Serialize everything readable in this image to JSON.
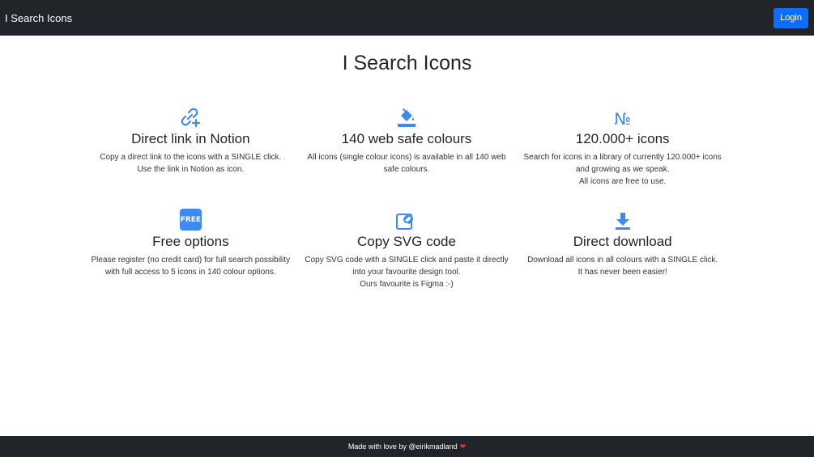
{
  "navbar": {
    "brand": "I Search Icons",
    "login_label": "Login"
  },
  "main": {
    "title": "I Search Icons"
  },
  "features": [
    {
      "icon": "link-plus-icon",
      "title": "Direct link in Notion",
      "lines": [
        "Copy a direct link to the icons with a SINGLE click.",
        "Use the link in Notion as icon."
      ]
    },
    {
      "icon": "paint-bucket-icon",
      "title": "140 web safe colours",
      "lines": [
        "All icons (single colour icons) is available in all 140 web safe colours."
      ]
    },
    {
      "icon": "numero-icon",
      "glyph": "№",
      "title": "120.000+ icons",
      "lines": [
        "Search for icons in a library of currently 120.000+ icons and growing as we speak.",
        "All icons are free to use."
      ]
    },
    {
      "icon": "free-badge-icon",
      "badge": "FREE",
      "title": "Free options",
      "lines": [
        "Please register (no credit card) for full search possibility with full access to 5 icons in 140 colour options."
      ]
    },
    {
      "icon": "copy-link-icon",
      "title": "Copy SVG code",
      "lines": [
        "Copy SVG code with a SINGLE click and paste it directly into your favourite design tool.",
        "Ours favourite is Figma :-)"
      ]
    },
    {
      "icon": "download-icon",
      "title": "Direct download",
      "lines": [
        "Download all icons in all colours with a SINGLE click.",
        "It has never been easier!"
      ]
    }
  ],
  "footer": {
    "text": "Made with love by @eirikmadland",
    "heart": "❤"
  },
  "colors": {
    "navbar_bg": "#212529",
    "accent": "#3d8bf2",
    "button": "#0d6efd",
    "heart": "#e0302e"
  }
}
